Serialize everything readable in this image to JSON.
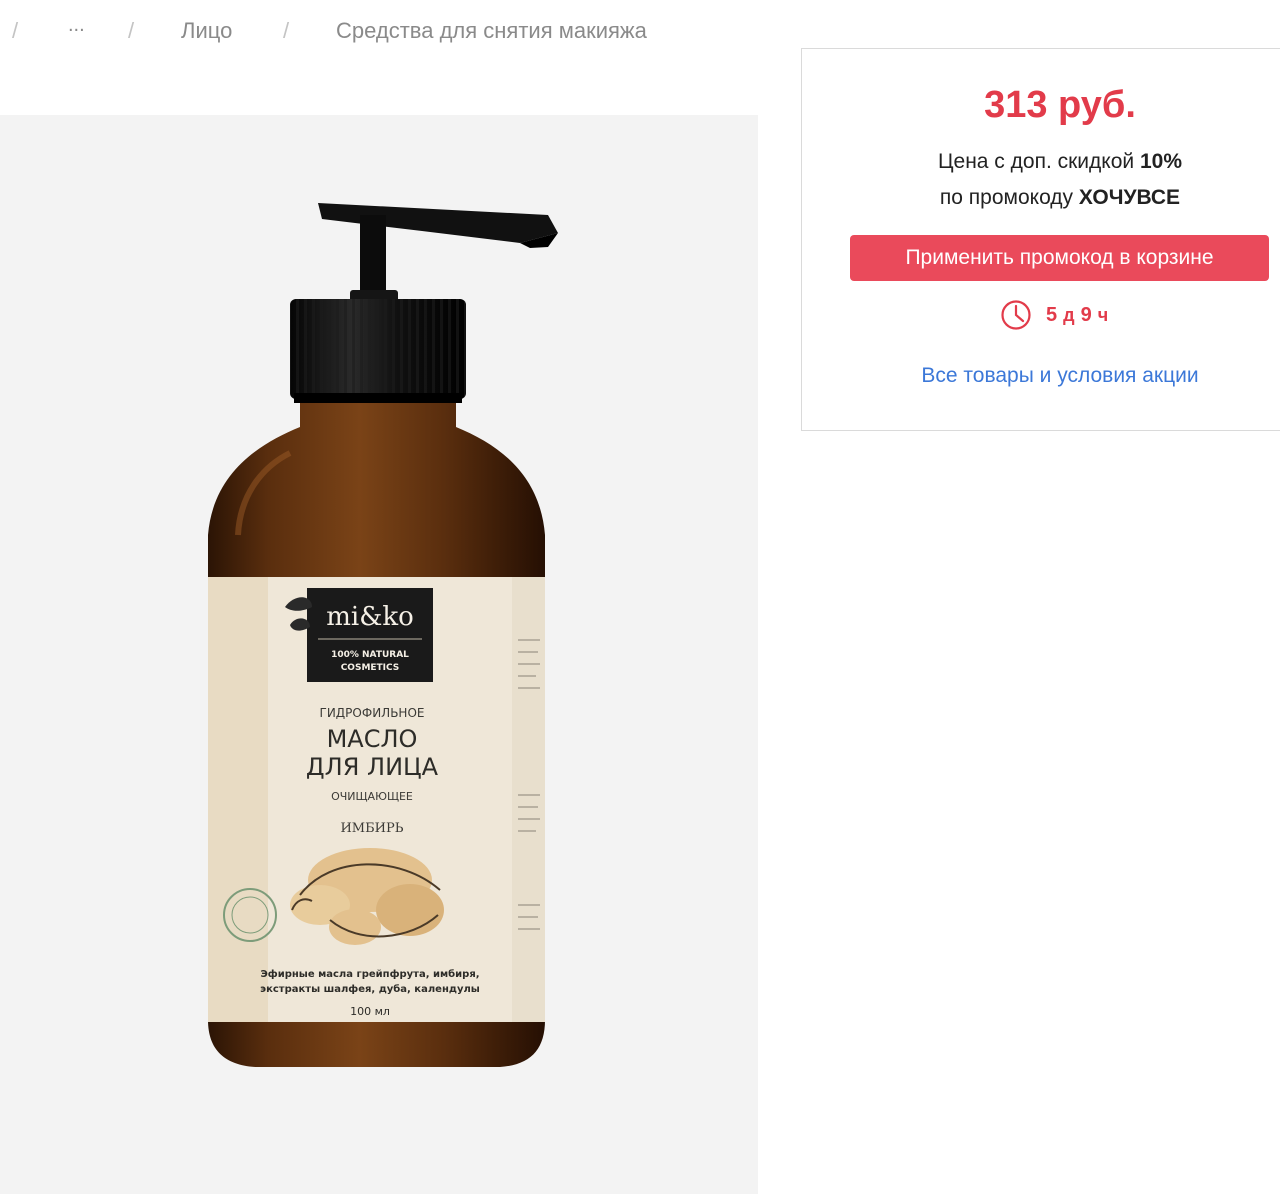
{
  "breadcrumb": {
    "separator": "/",
    "ellipsis": "...",
    "items": [
      "Лицо",
      "Средства для снятия макияжа"
    ]
  },
  "product": {
    "label": {
      "brand": "mi&ko",
      "brand_tag_line1": "100% NATURAL",
      "brand_tag_line2": "COSMETICS",
      "subtitle": "ГИДРОФИЛЬНОЕ",
      "title_line1": "МАСЛО",
      "title_line2": "ДЛЯ ЛИЦА",
      "descriptor": "ОЧИЩАЮЩЕЕ",
      "flavor": "ИМБИРЬ",
      "ingredients_line1": "Эфирные масла грейпфрута, имбиря,",
      "ingredients_line2": "экстракты шалфея, дуба, календулы",
      "volume": "100 мл"
    }
  },
  "promo": {
    "price": "313 руб.",
    "discount_text_prefix": "Цена с доп. скидкой",
    "discount_value": "10%",
    "promocode_prefix": "по промокоду",
    "promocode": "ХОЧУВСЕ",
    "apply_button": "Применить промокод в корзине",
    "timer": {
      "days": "5",
      "days_unit": "д",
      "hours": "9",
      "hours_unit": "ч"
    },
    "terms_link": "Все товары и условия акции"
  },
  "colors": {
    "accent_red": "#e23b4a",
    "button_red": "#ea4a5b",
    "link_blue": "#3c78d8"
  }
}
